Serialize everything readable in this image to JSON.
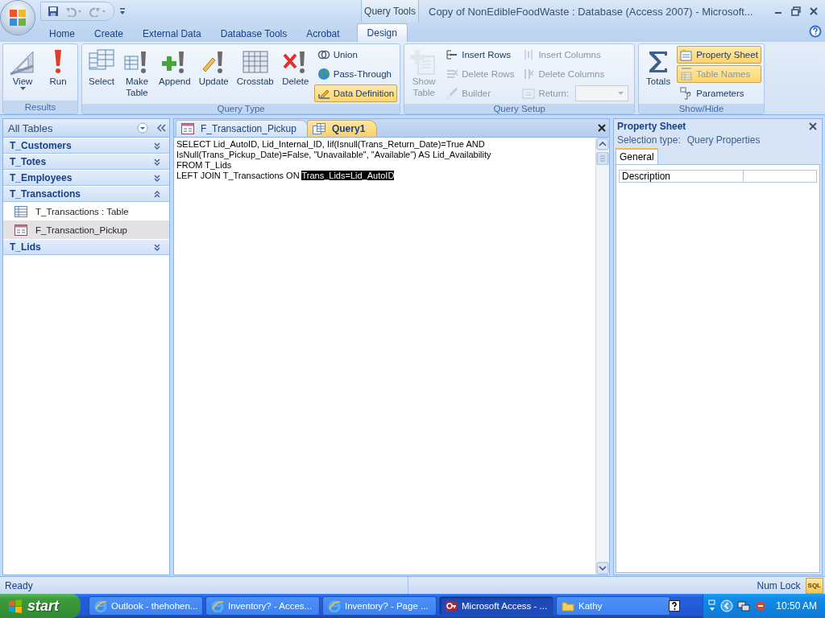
{
  "window": {
    "title": "Copy of NonEdibleFoodWaste : Database (Access 2007) - Microsoft...",
    "context_tools": "Query Tools"
  },
  "ribbon_tabs": [
    {
      "label": "Home",
      "selected": false
    },
    {
      "label": "Create",
      "selected": false
    },
    {
      "label": "External Data",
      "selected": false
    },
    {
      "label": "Database Tools",
      "selected": false
    },
    {
      "label": "Acrobat",
      "selected": false
    },
    {
      "label": "Design",
      "selected": true
    }
  ],
  "ribbon_groups": [
    {
      "label": "Results",
      "items": [
        {
          "kind": "large",
          "label": "View",
          "dropdown": true,
          "disabled": false,
          "on": false
        },
        {
          "kind": "large",
          "label": "Run",
          "disabled": false,
          "on": false
        }
      ]
    },
    {
      "label": "Query Type",
      "items": [
        {
          "kind": "large",
          "label": "Select",
          "disabled": false,
          "on": false
        },
        {
          "kind": "large",
          "label": "Make Table",
          "disabled": false,
          "on": false
        },
        {
          "kind": "large",
          "label": "Append",
          "disabled": false,
          "on": false
        },
        {
          "kind": "large",
          "label": "Update",
          "disabled": false,
          "on": false
        },
        {
          "kind": "large",
          "label": "Crosstab",
          "disabled": false,
          "on": false
        },
        {
          "kind": "large",
          "label": "Delete",
          "disabled": false,
          "on": false
        },
        {
          "kind": "stack",
          "buttons": [
            {
              "label": "Union",
              "disabled": false,
              "on": false
            },
            {
              "label": "Pass-Through",
              "disabled": false,
              "on": false
            },
            {
              "label": "Data Definition",
              "disabled": false,
              "on": true
            }
          ]
        }
      ]
    },
    {
      "label": "Query Setup",
      "items": [
        {
          "kind": "large",
          "label": "Show Table",
          "disabled": true,
          "on": false
        },
        {
          "kind": "stack",
          "buttons": [
            {
              "label": "Insert Rows",
              "disabled": false,
              "on": false
            },
            {
              "label": "Delete Rows",
              "disabled": true,
              "on": false
            },
            {
              "label": "Builder",
              "disabled": true,
              "on": false
            }
          ]
        },
        {
          "kind": "stack",
          "buttons": [
            {
              "label": "Insert Columns",
              "disabled": true,
              "on": false
            },
            {
              "label": "Delete Columns",
              "disabled": true,
              "on": false
            },
            {
              "label": "Return:",
              "disabled": true,
              "on": false,
              "combo": true
            }
          ]
        }
      ]
    },
    {
      "label": "Show/Hide",
      "items": [
        {
          "kind": "large",
          "label": "Totals",
          "disabled": false,
          "on": false
        },
        {
          "kind": "stack",
          "buttons": [
            {
              "label": "Property Sheet",
              "disabled": false,
              "on": true
            },
            {
              "label": "Table Names",
              "disabled": true,
              "on": true
            },
            {
              "label": "Parameters",
              "disabled": false,
              "on": false
            }
          ]
        }
      ]
    }
  ],
  "nav_pane": {
    "title": "All Tables",
    "groups": [
      {
        "label": "T_Customers",
        "expanded": false
      },
      {
        "label": "T_Totes",
        "expanded": false
      },
      {
        "label": "T_Employees",
        "expanded": false
      },
      {
        "label": "T_Transactions",
        "expanded": true,
        "children": [
          {
            "label": "T_Transactions : Table",
            "kind": "table",
            "selected": false
          },
          {
            "label": "F_Transaction_Pickup",
            "kind": "form",
            "selected": true
          }
        ]
      },
      {
        "label": "T_Lids",
        "expanded": false
      }
    ]
  },
  "document_tabs": [
    {
      "label": "F_Transaction_Pickup",
      "kind": "form",
      "selected": false
    },
    {
      "label": "Query1",
      "kind": "query",
      "selected": true
    }
  ],
  "sql_editor": {
    "lines": [
      {
        "text": "SELECT Lid_AutoID, Lid_Internal_ID, Iif(Isnull(Trans_Return_Date)=True AND"
      },
      {
        "text": "IsNull(Trans_Pickup_Date)=False, \"Unavailable\", \"Available\") AS Lid_Availability"
      },
      {
        "text": "FROM T_Lids"
      },
      {
        "text": "LEFT JOIN T_Transactions ON ",
        "selection": "Trans_Lids=Lid_AutoID"
      }
    ]
  },
  "property_sheet": {
    "title": "Property Sheet",
    "selection_type_label": "Selection type:",
    "selection_type": "Query Properties",
    "tabs": [
      {
        "label": "General",
        "selected": true
      }
    ],
    "properties": [
      {
        "name": "Description"
      }
    ]
  },
  "status_bar": {
    "status": "Ready",
    "indicator": "Num Lock",
    "view_buttons": [
      {
        "label": "SQL",
        "selected": true
      }
    ]
  },
  "taskbar": {
    "start": "start",
    "tasks": [
      {
        "label": "Outlook - thehohen...",
        "kind": "browser",
        "selected": false
      },
      {
        "label": "Inventory? - Acces...",
        "kind": "browser",
        "selected": false
      },
      {
        "label": "Inventory? - Page ...",
        "kind": "browser",
        "selected": false
      },
      {
        "label": "Microsoft Access - ...",
        "kind": "access",
        "selected": true
      },
      {
        "label": "Kathy",
        "kind": "folder",
        "selected": false
      }
    ],
    "clock": "10:50 AM"
  }
}
